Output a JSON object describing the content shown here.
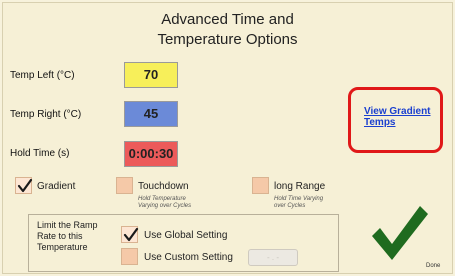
{
  "title": {
    "line1": "Advanced Time and",
    "line2": "Temperature Options"
  },
  "fields": {
    "temp_left": {
      "label": "Temp Left (°C)",
      "value": "70"
    },
    "temp_right": {
      "label": "Temp Right (°C)",
      "value": "45"
    },
    "hold_time": {
      "label": "Hold Time (s)",
      "value": "0:00:30"
    }
  },
  "gradient_link": {
    "line1": "View Gradient",
    "line2": "Temps"
  },
  "options": {
    "gradient": {
      "label": "Gradient",
      "checked": true
    },
    "touchdown": {
      "label": "Touchdown",
      "sub1": "Hold Temperature",
      "sub2": "Varying over Cycles",
      "checked": false
    },
    "long_range": {
      "label": "long Range",
      "sub1": "Hold Time Varying",
      "sub2": "over Cycles",
      "checked": false
    }
  },
  "ramp": {
    "label_lines": [
      "Limit the Ramp",
      "Rate to this",
      "Temperature"
    ],
    "use_global": {
      "label": "Use Global Setting",
      "checked": true
    },
    "use_custom": {
      "label": "Use Custom Setting",
      "checked": false
    },
    "custom_value": "- . -"
  },
  "done": {
    "label": "Done"
  },
  "colors": {
    "temp_left_bg": "#f7ef5a",
    "temp_right_bg": "#6b8ad8",
    "hold_bg": "#ec5a5a",
    "highlight": "#e01818",
    "link": "#1a3fcf",
    "check": "#1f6b1f"
  }
}
